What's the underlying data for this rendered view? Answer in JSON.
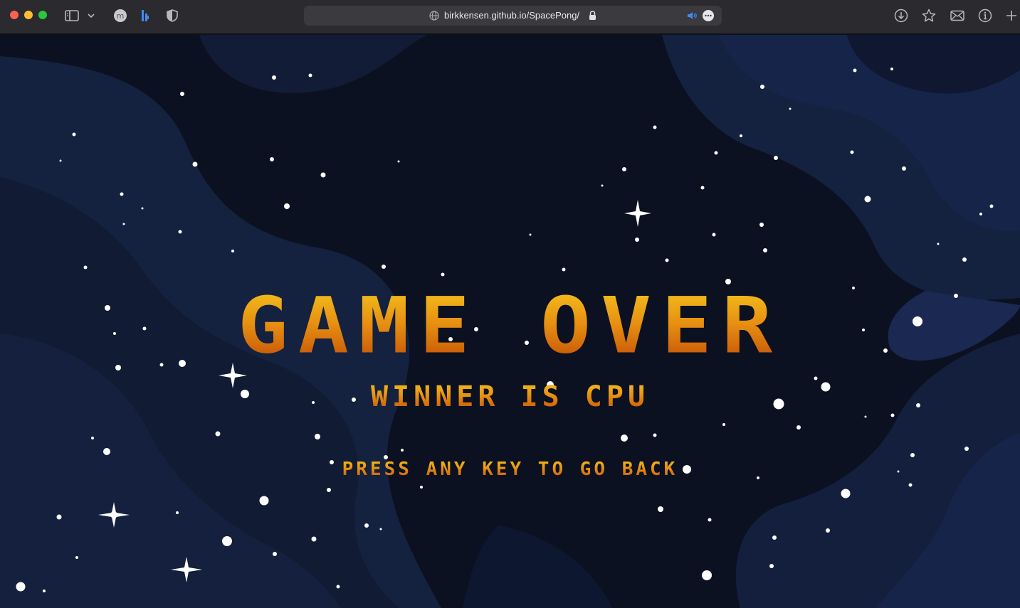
{
  "browser": {
    "url": "birkkensen.github.io/SpacePong/"
  },
  "icons": [
    "traffic-light-close-icon",
    "traffic-light-minimize-icon",
    "traffic-light-zoom-icon",
    "sidebar-icon",
    "chevron-down-icon",
    "extension-m-icon",
    "extension-b-icon",
    "shield-icon",
    "globe-icon",
    "lock-icon",
    "speaker-icon",
    "more-icon",
    "download-icon",
    "star-icon",
    "mail-icon",
    "info-icon",
    "new-tab-icon"
  ],
  "colors": {
    "background": "#0b1120",
    "nebula": "#14213f",
    "title_top": "#f3c11e",
    "title_bottom": "#c24d05"
  },
  "game": {
    "title": "GAME OVER",
    "winner": "WINNER IS CPU",
    "prompt": "PRESS ANY KEY TO GO BACK"
  }
}
